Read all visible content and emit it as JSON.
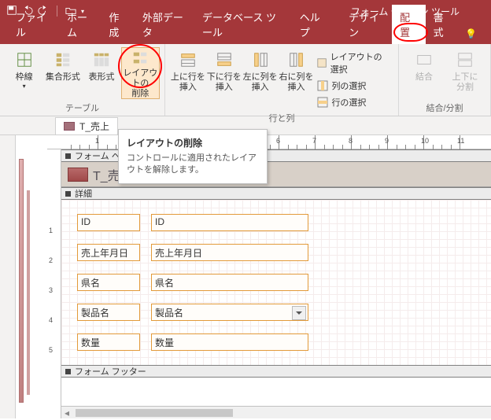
{
  "title_tool": "フォーム デザイン ツール",
  "ribbon_tabs": {
    "file": "ファイル",
    "home": "ホーム",
    "create": "作成",
    "external": "外部データ",
    "dbtools": "データベース ツール",
    "help": "ヘルプ",
    "design": "デザイン",
    "arrange": "配置",
    "format": "書式"
  },
  "groups": {
    "table": "テーブル",
    "rowscols": "行と列",
    "mergesplit": "結合/分割"
  },
  "buttons": {
    "gridlines": "枠線",
    "stacked": "集合形式",
    "tabular": "表形式",
    "remove_layout": "レイアウトの\n削除",
    "insert_above": "上に行を\n挿入",
    "insert_below": "下に行を\n挿入",
    "insert_left": "左に列を\n挿入",
    "insert_right": "右に列を\n挿入",
    "select_layout": "レイアウトの選択",
    "select_column": "列の選択",
    "select_row": "行の選択",
    "merge": "結合",
    "split_vert": "上下に\n分割"
  },
  "tooltip": {
    "title": "レイアウトの削除",
    "body": "コントロールに適用されたレイアウトを解除します。"
  },
  "doc_tab": "T_売上",
  "form": {
    "header_section": "フォーム ヘッダー",
    "title": "T_売上",
    "detail_section": "詳細",
    "footer_section": "フォーム フッター",
    "fields": [
      {
        "label": "ID",
        "bound": "ID"
      },
      {
        "label": "売上年月日",
        "bound": "売上年月日"
      },
      {
        "label": "県名",
        "bound": "県名"
      },
      {
        "label": "製品名",
        "bound": "製品名"
      },
      {
        "label": "数量",
        "bound": "数量"
      }
    ]
  },
  "ruler_marks": [
    "1",
    "2",
    "3",
    "4",
    "5",
    "6",
    "7",
    "8",
    "9",
    "10",
    "11"
  ]
}
